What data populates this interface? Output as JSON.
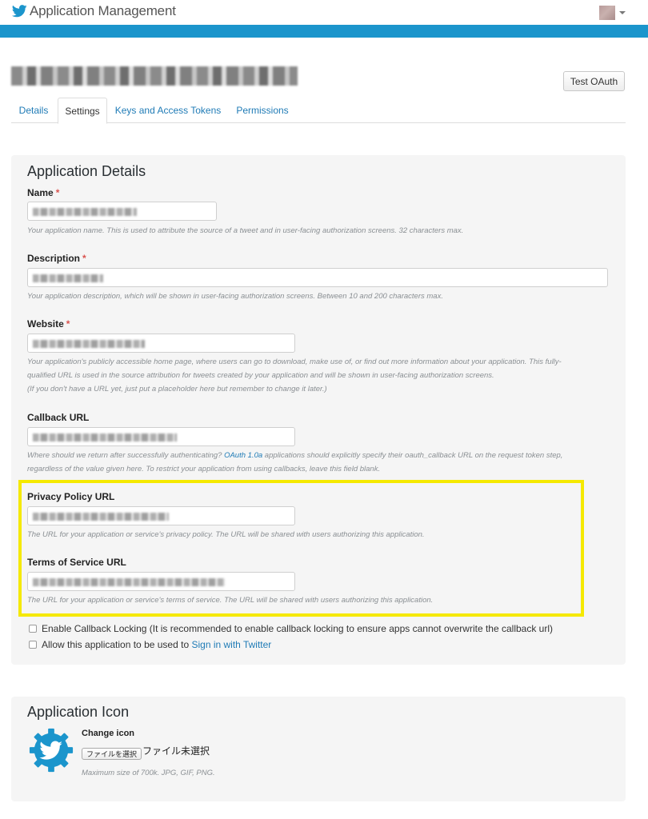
{
  "header": {
    "title": "Application Management",
    "accent_color": "#1b95cc",
    "logo_icon": "twitter-bird-icon"
  },
  "app": {
    "test_oauth_label": "Test OAuth"
  },
  "tabs": [
    {
      "label": "Details",
      "active": false
    },
    {
      "label": "Settings",
      "active": true
    },
    {
      "label": "Keys and Access Tokens",
      "active": false
    },
    {
      "label": "Permissions",
      "active": false
    }
  ],
  "details": {
    "heading": "Application Details",
    "required_marker": "*",
    "name_label": "Name",
    "name_help": "Your application name. This is used to attribute the source of a tweet and in user-facing authorization screens. 32 characters max.",
    "description_label": "Description",
    "description_help": "Your application description, which will be shown in user-facing authorization screens. Between 10 and 200 characters max.",
    "website_label": "Website",
    "website_help_1": "Your application's publicly accessible home page, where users can go to download, make use of, or find out more information about your application. This fully-",
    "website_help_2": "qualified URL is used in the source attribution for tweets created by your application and will be shown in user-facing authorization screens.",
    "website_help_3": "(If you don't have a URL yet, just put a placeholder here but remember to change it later.)",
    "callback_label": "Callback URL",
    "callback_help_1_pre": "Where should we return after successfully authenticating?",
    "callback_help_1_link": "OAuth 1.0a",
    "callback_help_1_post": "applications should explicitly specify their oauth_callback URL on the request token step,",
    "callback_help_2": "regardless of the value given here. To restrict your application from using callbacks, leave this field blank.",
    "privacy_label": "Privacy Policy URL",
    "privacy_help": "The URL for your application or service's privacy policy. The URL will be shared with users authorizing this application.",
    "tos_label": "Terms of Service URL",
    "tos_help": "The URL for your application or service's terms of service. The URL will be shared with users authorizing this application.",
    "callback_locking_label": "Enable Callback Locking (It is recommended to enable callback locking to ensure apps cannot overwrite the callback url)",
    "callback_locking_checked": false,
    "sign_in_label_pre": "Allow this application to be used to",
    "sign_in_label_link": "Sign in with Twitter",
    "sign_in_checked": false
  },
  "icon_section": {
    "heading": "Application Icon",
    "change_icon_label": "Change icon",
    "file_button_label": "ファイルを選択",
    "file_status": "ファイル未選択",
    "size_help": "Maximum size of 700k. JPG, GIF, PNG."
  }
}
